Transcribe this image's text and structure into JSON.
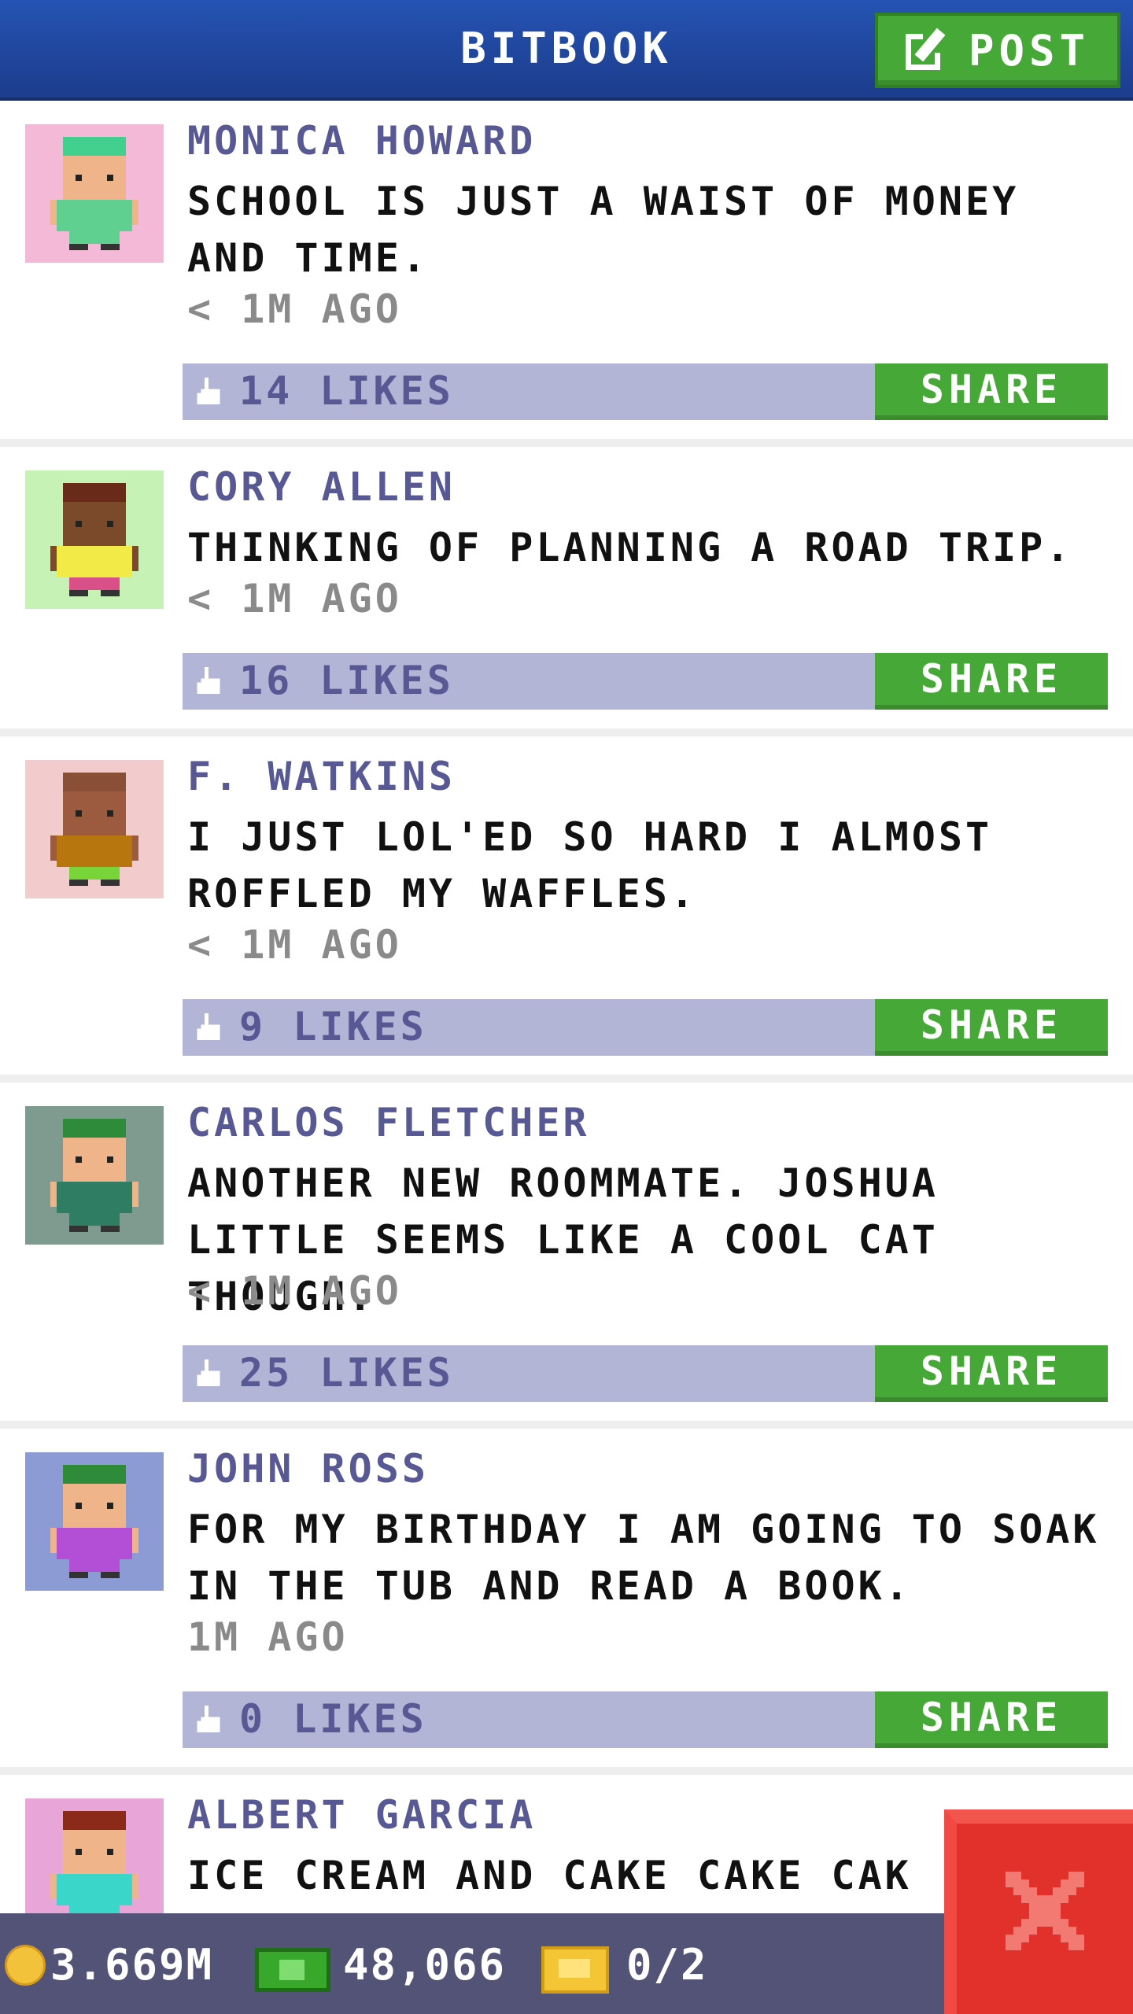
{
  "header": {
    "title": "BITBOOK",
    "post_label": "POST"
  },
  "posts": [
    {
      "name": "MONICA HOWARD",
      "text": "SCHOOL IS JUST A WAIST OF MONEY AND TIME.",
      "time": "< 1M AGO",
      "likes": "14 LIKES",
      "share": "SHARE",
      "avatar": {
        "bg": "#f3b9d6",
        "hair": "#43d08e",
        "skin": "#f0b48a",
        "shirt": "#5fd08f",
        "pants": "#5fd08f"
      }
    },
    {
      "name": "CORY ALLEN",
      "text": "THINKING OF PLANNING A ROAD TRIP.",
      "time": "< 1M AGO",
      "likes": "16 LIKES",
      "share": "SHARE",
      "avatar": {
        "bg": "#c6f2b6",
        "hair": "#6a2a1a",
        "skin": "#7a4a2a",
        "shirt": "#f2ea47",
        "pants": "#d94f87"
      }
    },
    {
      "name": "F. WATKINS",
      "text": "I JUST LOL'ED SO HARD I ALMOST ROFFLED MY WAFFLES.",
      "time": "< 1M AGO",
      "likes": "9 LIKES",
      "share": "SHARE",
      "avatar": {
        "bg": "#f2cccc",
        "hair": "#8a4f37",
        "skin": "#9c5a3f",
        "shirt": "#b8770e",
        "pants": "#79d43a"
      }
    },
    {
      "name": "CARLOS FLETCHER",
      "text": "ANOTHER NEW ROOMMATE. JOSHUA LITTLE SEEMS LIKE A COOL CAT THOUGH.",
      "time": "< 1M AGO",
      "likes": "25 LIKES",
      "share": "SHARE",
      "avatar": {
        "bg": "#7f9a8e",
        "hair": "#2d8b3a",
        "skin": "#f0b48a",
        "shirt": "#2f7d63",
        "pants": "#2f7d63"
      }
    },
    {
      "name": "JOHN ROSS",
      "text": "FOR MY BIRTHDAY I AM GOING TO SOAK IN THE TUB AND READ A BOOK.",
      "time": "1M AGO",
      "likes": "0 LIKES",
      "share": "SHARE",
      "avatar": {
        "bg": "#8c9bd3",
        "hair": "#2d8b3a",
        "skin": "#f0b48a",
        "shirt": "#b24fd6",
        "pants": "#b24fd6"
      }
    },
    {
      "name": "ALBERT GARCIA",
      "text": "ICE CREAM AND CAKE CAKE CAK",
      "time": "",
      "likes": "",
      "share": "",
      "avatar": {
        "bg": "#e8a6d8",
        "hair": "#8c2a1a",
        "skin": "#f0b48a",
        "shirt": "#3ad6c9",
        "pants": "#3ad6c9"
      }
    }
  ],
  "status": {
    "coins": "3.669M",
    "cash": "48,066",
    "tickets": "0/2"
  },
  "icons": {
    "post": "edit-icon",
    "like": "thumbs-up-icon",
    "coin": "coin-icon",
    "cash": "cash-icon",
    "ticket": "ticket-icon",
    "close": "close-icon"
  }
}
